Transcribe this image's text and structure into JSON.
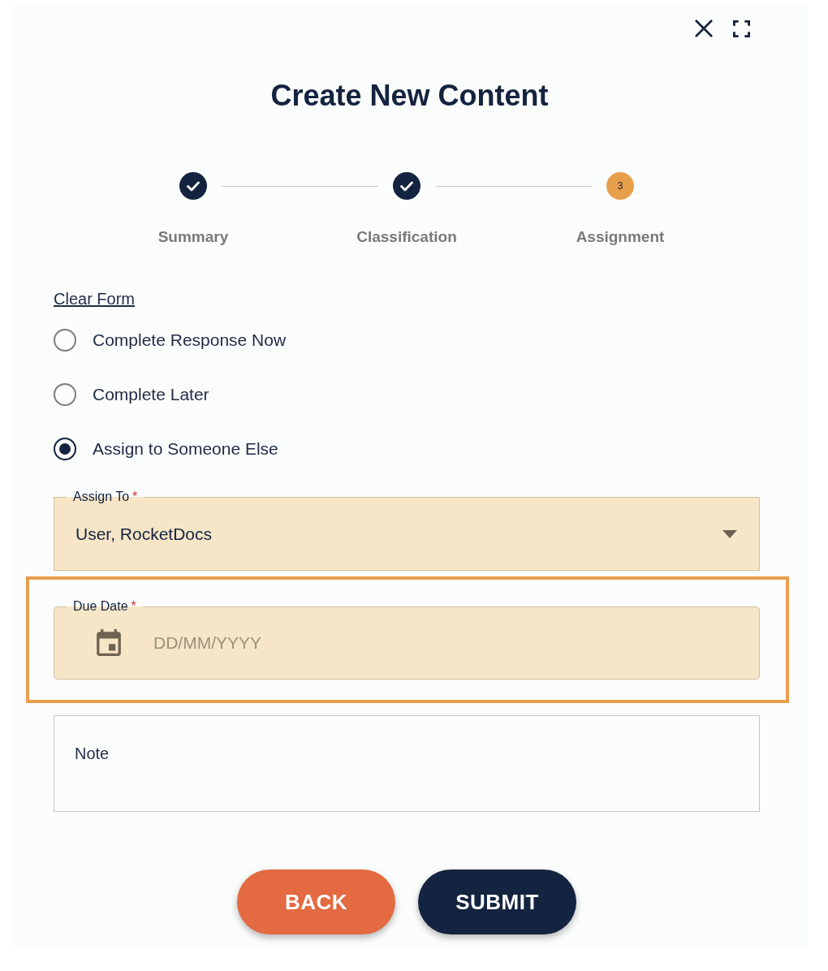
{
  "dialog": {
    "title": "Create New Content"
  },
  "steps": [
    {
      "label": "Summary",
      "completed": true
    },
    {
      "label": "Classification",
      "completed": true
    },
    {
      "label": "Assignment",
      "completed": false,
      "number": "3"
    }
  ],
  "clear_form_link": "Clear Form",
  "options": [
    {
      "label": "Complete Response Now",
      "selected": false
    },
    {
      "label": "Complete Later",
      "selected": false
    },
    {
      "label": "Assign to Someone Else",
      "selected": true
    }
  ],
  "fields": [
    {
      "kind": "select",
      "label": "Assign To",
      "required_mark": "*",
      "value": "User, RocketDocs",
      "highlighted": false
    },
    {
      "kind": "date",
      "label": "Due Date",
      "required_mark": "*",
      "placeholder": "DD/MM/YYYY",
      "highlighted": true
    },
    {
      "kind": "textarea",
      "placeholder": "Note",
      "highlighted": false
    }
  ],
  "buttons": [
    {
      "label": "BACK",
      "kind": "secondary"
    },
    {
      "label": "SUBMIT",
      "kind": "primary"
    }
  ]
}
